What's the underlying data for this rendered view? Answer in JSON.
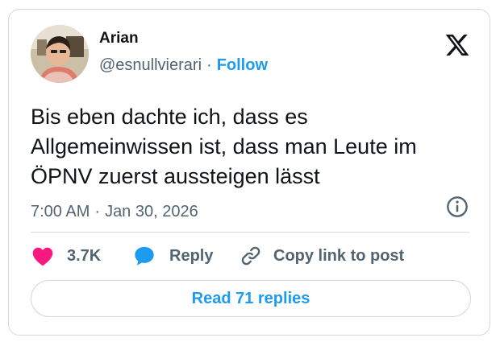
{
  "author": {
    "name": "Arian",
    "handle": "@esnullvierari",
    "separator": "·",
    "follow_label": "Follow"
  },
  "tweet": {
    "text": "Bis eben dachte ich, dass es\nAllgemeinwissen ist, dass man Leute im\nÖPNV zuerst aussteigen lässt",
    "time": "7:00 AM",
    "separator": "·",
    "date": "Jan 30, 2026"
  },
  "actions": {
    "like_count": "3.7K",
    "reply_label": "Reply",
    "copy_label": "Copy link to post"
  },
  "read_replies_label": "Read 71 replies",
  "icons": {
    "brand": "x-logo-icon",
    "info": "info-icon",
    "like": "heart-icon",
    "reply": "speech-bubble-icon",
    "copy": "link-icon"
  },
  "colors": {
    "like": "#f91880",
    "reply": "#1d9bf0",
    "follow": "#1d9bf0",
    "text": "#0f1419",
    "muted": "#536471",
    "border": "#cfd9de"
  }
}
